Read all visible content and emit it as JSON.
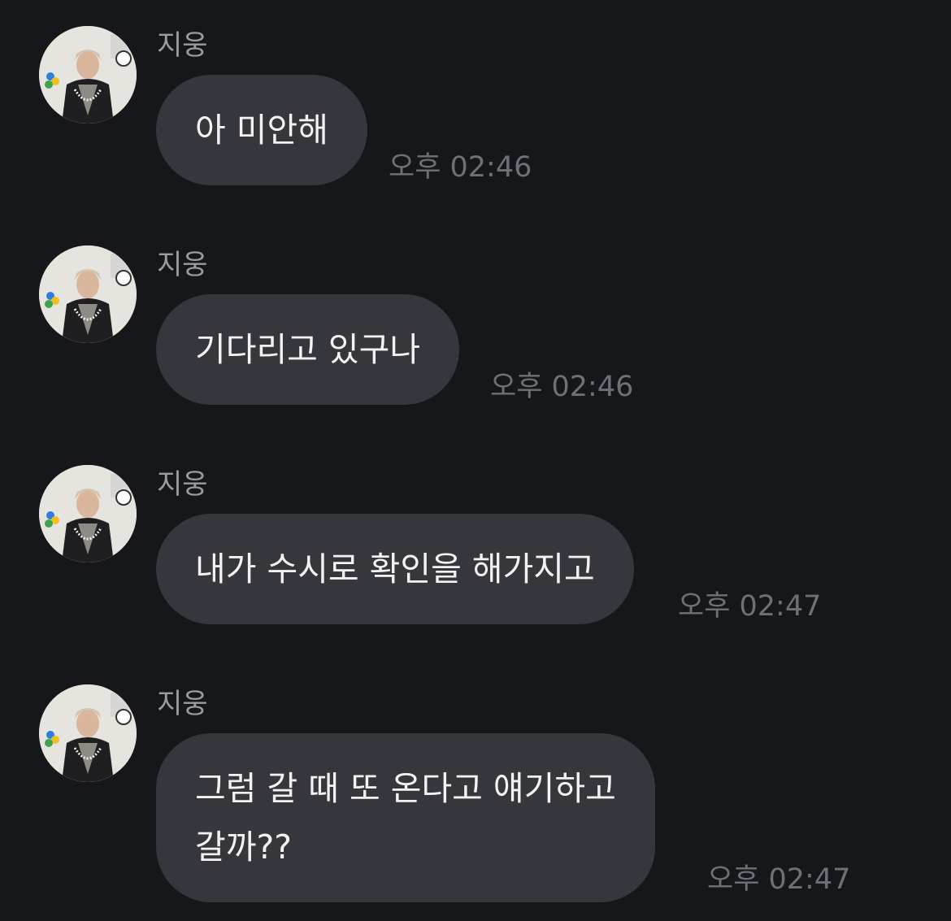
{
  "messages": [
    {
      "sender": "지웅",
      "lines": [
        "아 미안해"
      ],
      "time": "오후 02:46"
    },
    {
      "sender": "지웅",
      "lines": [
        "기다리고 있구나"
      ],
      "time": "오후 02:46"
    },
    {
      "sender": "지웅",
      "lines": [
        "내가 수시로 확인을 해가지고"
      ],
      "time": "오후 02:47"
    },
    {
      "sender": "지웅",
      "lines": [
        "그럼 갈 때 또 온다고 얘기하고",
        "갈까??"
      ],
      "time": "오후 02:47"
    }
  ],
  "colors": {
    "background": "#16171b",
    "bubble": "#36373c",
    "bubble_text": "#f2f2f4",
    "sender_text": "#9a9ca3",
    "time_text": "#6e7077"
  }
}
